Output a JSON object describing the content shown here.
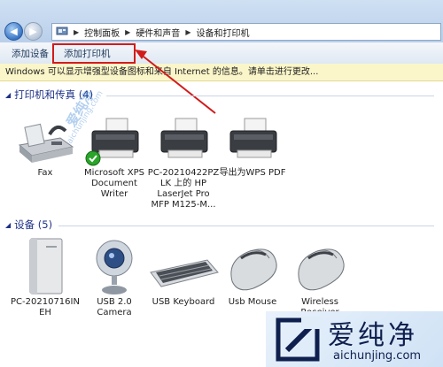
{
  "address": {
    "crumbs": [
      "控制面板",
      "硬件和声音",
      "设备和打印机"
    ]
  },
  "toolbar": {
    "add_device": "添加设备",
    "add_printer": "添加打印机"
  },
  "infobar": {
    "text": "Windows 可以显示增强型设备图标和来自 Internet 的信息。请单击进行更改..."
  },
  "printers": {
    "header": "打印机和传真 (4)",
    "items": [
      {
        "label": "Fax",
        "icon": "fax-icon"
      },
      {
        "label": "Microsoft XPS\nDocument\nWriter",
        "icon": "printer-icon",
        "default": true
      },
      {
        "label": "PC-20210422PZ\nLK 上的 HP\nLaserJet Pro\nMFP M125-M...",
        "icon": "printer-icon"
      },
      {
        "label": "导出为WPS PDF",
        "icon": "printer-icon"
      }
    ]
  },
  "devices": {
    "header": "设备 (5)",
    "items": [
      {
        "label": "PC-20210716IN\nEH",
        "icon": "computer-tower-icon"
      },
      {
        "label": "USB 2.0\nCamera",
        "icon": "webcam-icon"
      },
      {
        "label": "USB Keyboard",
        "icon": "keyboard-icon"
      },
      {
        "label": "Usb Mouse",
        "icon": "mouse-icon"
      },
      {
        "label": "Wireless\nReceiver",
        "icon": "mouse-icon"
      }
    ]
  },
  "watermark": {
    "main": "爱纯净",
    "sub": "aichunjing.com",
    "ghost_main": "爱纯净",
    "ghost_sub": "aichunjing.com"
  },
  "colors": {
    "accent": "#d11b1b",
    "header_text": "#1e3287",
    "infobar_bg": "#fbf6c9"
  }
}
